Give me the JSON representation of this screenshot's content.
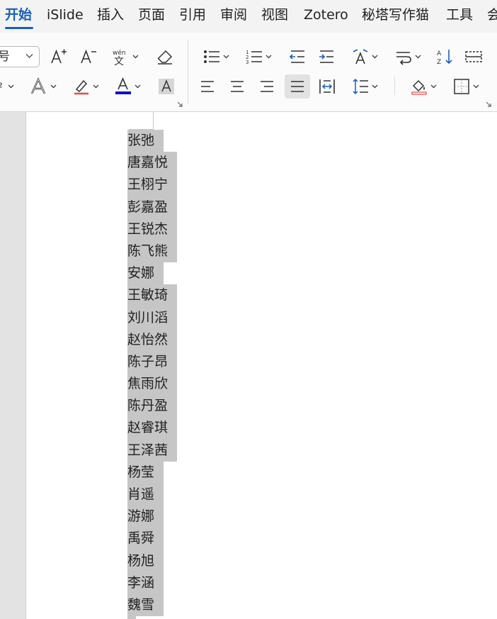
{
  "menu": {
    "tabs": [
      {
        "label": "开始",
        "active": true
      },
      {
        "label": "iSlide",
        "active": false
      },
      {
        "label": "插入",
        "active": false
      },
      {
        "label": "页面",
        "active": false
      },
      {
        "label": "引用",
        "active": false
      },
      {
        "label": "审阅",
        "active": false
      },
      {
        "label": "视图",
        "active": false
      },
      {
        "label": "Zotero",
        "active": false
      },
      {
        "label": "秘塔写作猫",
        "active": false
      },
      {
        "label": "工具",
        "active": false
      },
      {
        "label": "会",
        "active": false
      }
    ]
  },
  "ribbon": {
    "font_size_value": "号",
    "row2_left_glyph": "²",
    "font_color": "#1010c8",
    "highlight_color": "#e24b4b",
    "accent_color": "#1a5fb4",
    "buttons": [
      "increase-font-size-icon",
      "decrease-font-size-icon",
      "phonetic-guide-icon",
      "clear-formatting-icon",
      "bullet-list-icon",
      "numbered-list-icon",
      "decrease-indent-icon",
      "increase-indent-icon",
      "text-direction-icon",
      "line-break-icon",
      "sort-icon",
      "table-icon",
      "text-effect-icon",
      "highlight-icon",
      "font-color-icon",
      "character-shading-icon",
      "align-left-icon",
      "align-center-icon",
      "align-right-icon",
      "justify-icon",
      "distributed-icon",
      "line-spacing-icon",
      "shading-icon",
      "borders-icon"
    ],
    "active_alignment": "justify"
  },
  "document": {
    "names": [
      "张弛",
      "唐嘉悦",
      "王栩宁",
      "彭嘉盈",
      "王锐杰",
      "陈飞熊",
      "安娜",
      "王敏琦",
      "刘川滔",
      "赵怡然",
      "陈子昂",
      "焦雨欣",
      "陈丹盈",
      "赵睿琪",
      "王泽茜",
      "杨莹",
      "肖遥",
      "游娜",
      "禹舜",
      "杨旭",
      "李涵",
      "魏雪"
    ]
  }
}
